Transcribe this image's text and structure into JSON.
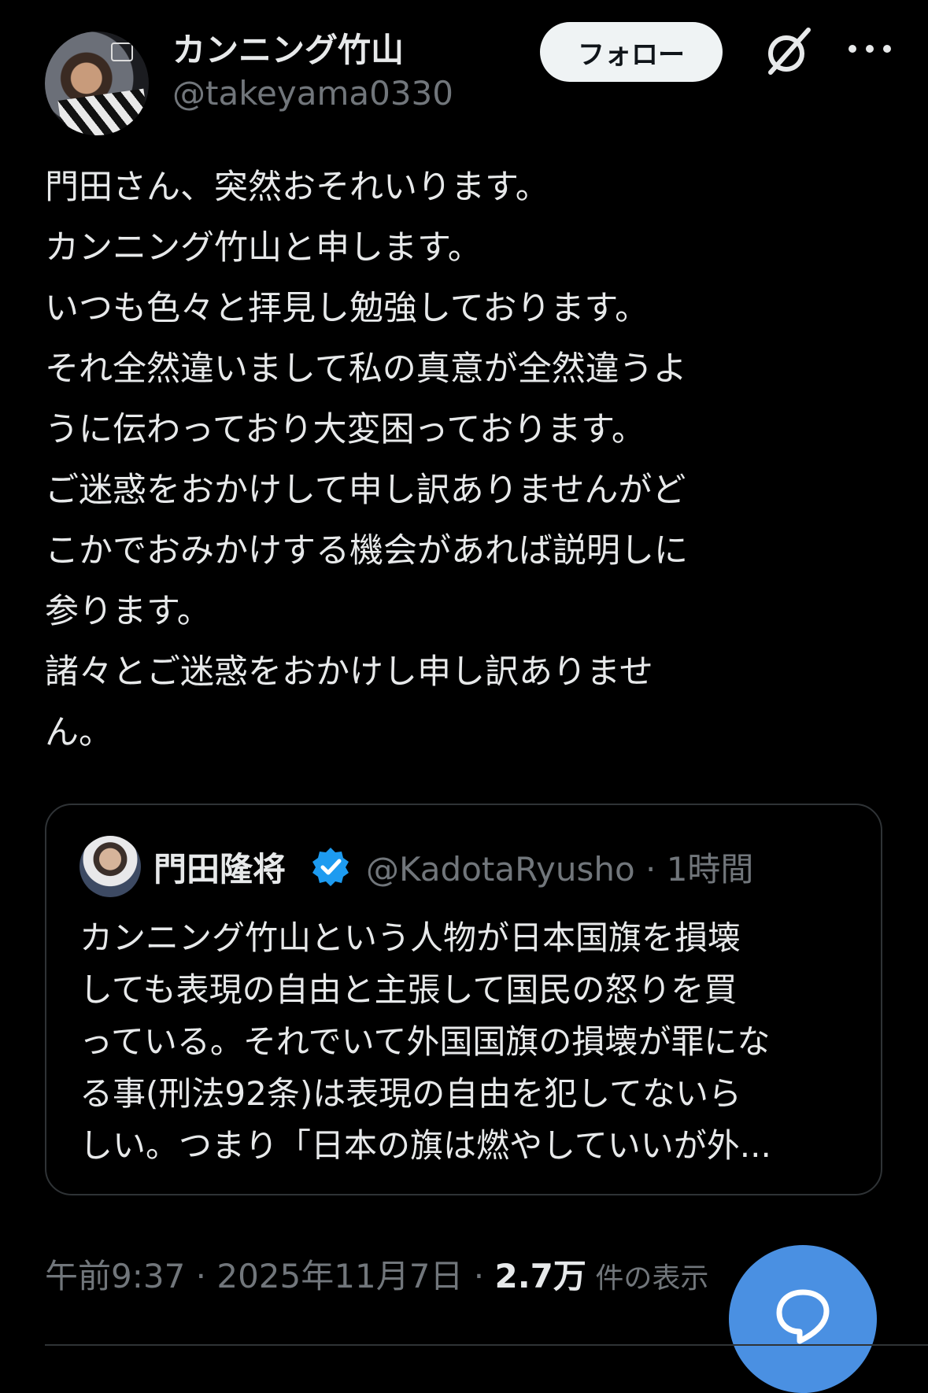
{
  "author": {
    "name": "カンニング竹山",
    "handle": "@takeyama0330",
    "avatar_icon": "user-avatar"
  },
  "actions": {
    "follow_label": "フォロー",
    "grok_icon": "grok-icon",
    "more_icon": "more-icon"
  },
  "tweet": {
    "lines": [
      "門田さん、突然おそれいります。",
      "カンニング竹山と申します。",
      "いつも色々と拝見し勉強しております。",
      "それ全然違いまして私の真意が全然違うよ",
      "うに伝わっており大変困っております。",
      "ご迷惑をおかけして申し訳ありませんがど",
      "こかでおみかけする機会があれば説明しに",
      "参ります。",
      "諸々とご迷惑をおかけし申し訳ありませ",
      "ん。"
    ]
  },
  "quote": {
    "name": "門田隆将",
    "handle_time": "@KadotaRyusho · 1時間",
    "verified_color": "#1d9bf0",
    "lines": [
      "カンニング竹山という人物が日本国旗を損壊",
      "しても表現の自由と主張して国民の怒りを買",
      "っている。それでいて外国国旗の損壊が罪にな",
      "る事(刑法92条)は表現の自由を犯してないら",
      "しい。つまり「日本の旗は燃やしていいが外..."
    ]
  },
  "meta": {
    "time_date": "午前9:37 · 2025年11月7日 · ",
    "views_count": "2.7万",
    "views_label": " 件の表示"
  },
  "compose": {
    "icon": "reply-bubble-icon",
    "color": "#4a90e2"
  }
}
